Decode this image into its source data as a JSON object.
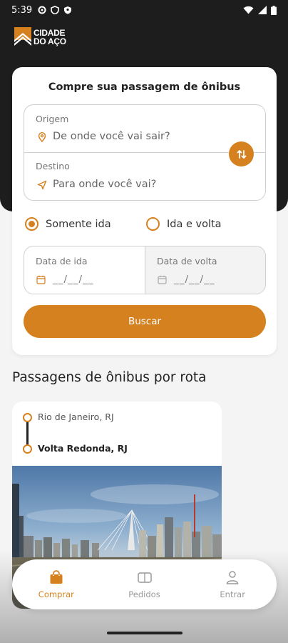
{
  "status_bar": {
    "time": "5:39"
  },
  "brand": {
    "logo_text_line1": "CIDADE",
    "logo_text_line2": "DO AÇO",
    "accent_color": "#d5811f"
  },
  "search": {
    "title": "Compre sua passagem de ônibus",
    "origin_label": "Origem",
    "origin_placeholder": "De onde você vai sair?",
    "destination_label": "Destino",
    "destination_placeholder": "Para onde você vai?",
    "trip_options": [
      {
        "label": "Somente ida",
        "selected": true
      },
      {
        "label": "Ida e volta",
        "selected": false
      }
    ],
    "departure_date_label": "Data de ida",
    "departure_date_value": "__/__/__",
    "return_date_label": "Data de volta",
    "return_date_value": "__/__/__",
    "search_button": "Buscar"
  },
  "routes_section": {
    "title": "Passagens de ônibus por rota",
    "routes": [
      {
        "from": "Rio de Janeiro, RJ",
        "to": "Volta Redonda, RJ"
      }
    ]
  },
  "bottom_nav": {
    "items": [
      {
        "label": "Comprar",
        "icon": "shopping-bag-icon",
        "active": true
      },
      {
        "label": "Pedidos",
        "icon": "ticket-icon",
        "active": false
      },
      {
        "label": "Entrar",
        "icon": "user-icon",
        "active": false
      }
    ]
  }
}
